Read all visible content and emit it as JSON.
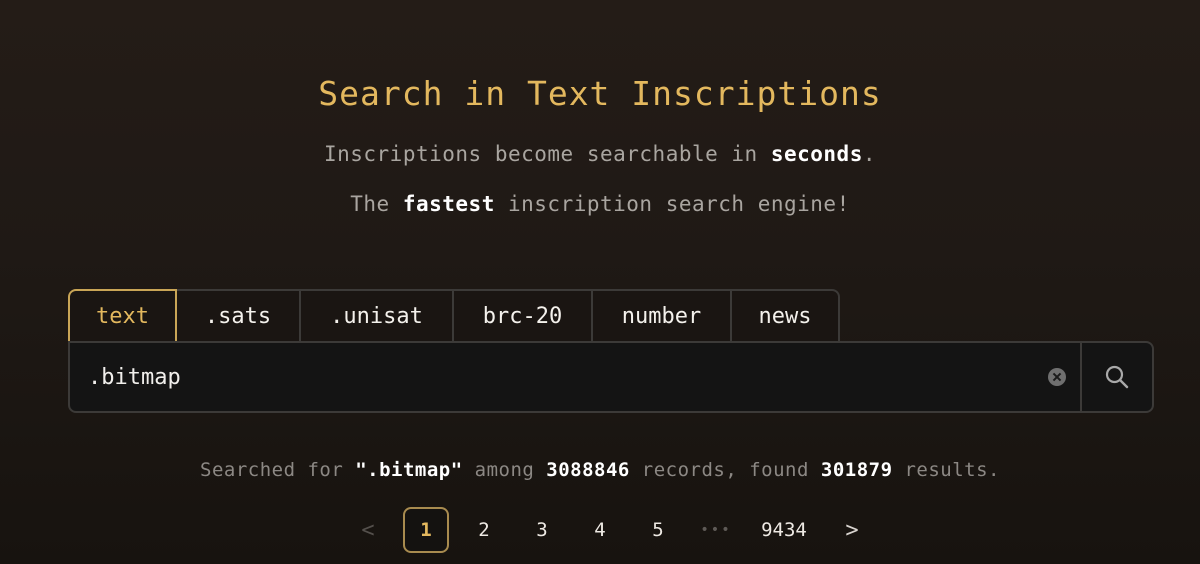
{
  "header": {
    "title": "Search in Text Inscriptions",
    "subtitle1": {
      "pre": "Inscriptions become searchable in ",
      "bold": "seconds",
      "post": "."
    },
    "subtitle2": {
      "pre": "The ",
      "bold": "fastest",
      "post": " inscription search engine!"
    }
  },
  "tabs": [
    {
      "label": "text",
      "active": true
    },
    {
      "label": ".sats",
      "active": false
    },
    {
      "label": ".unisat",
      "active": false
    },
    {
      "label": "brc-20",
      "active": false
    },
    {
      "label": "number",
      "active": false
    },
    {
      "label": "news",
      "active": false
    }
  ],
  "search": {
    "value": ".bitmap",
    "placeholder": "",
    "clear_icon": "clear-circle-icon",
    "submit_icon": "search-icon"
  },
  "result": {
    "pre": "Searched for ",
    "query": "\".bitmap\"",
    "mid1": " among ",
    "records": "3088846",
    "mid2": " records, found ",
    "found": "301879",
    "post": " results."
  },
  "pagination": {
    "prev_icon": "chevron-left-icon",
    "next_icon": "chevron-right-icon",
    "prev_label": "<",
    "next_label": ">",
    "pages": [
      "1",
      "2",
      "3",
      "4",
      "5"
    ],
    "current": "1",
    "ellipsis": "•••",
    "last": "9434"
  },
  "colors": {
    "accent": "#e3b85e",
    "background": "#1f1915",
    "border": "#3c3a38"
  }
}
